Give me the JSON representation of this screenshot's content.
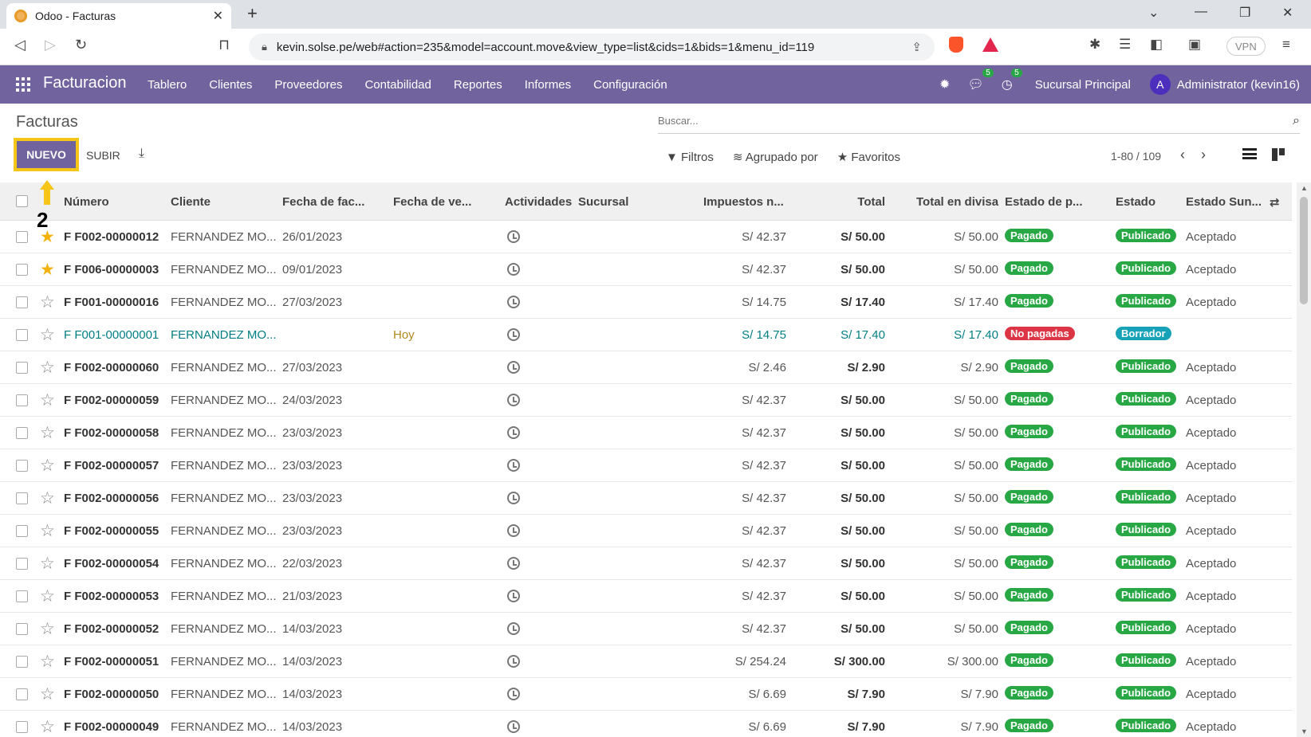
{
  "browser": {
    "tab_title": "Odoo - Facturas",
    "url": "kevin.solse.pe/web#action=235&model=account.move&view_type=list&cids=1&bids=1&menu_id=119",
    "vpn_label": "VPN"
  },
  "navbar": {
    "brand": "Facturacion",
    "menu": [
      "Tablero",
      "Clientes",
      "Proveedores",
      "Contabilidad",
      "Reportes",
      "Informes",
      "Configuración"
    ],
    "messages_count": "5",
    "activities_count": "5",
    "branch": "Sucursal Principal",
    "avatar_letter": "A",
    "user": "Administrator (kevin16)",
    "color": "#71639e"
  },
  "control": {
    "breadcrumb": "Facturas",
    "search_placeholder": "Buscar...",
    "new_label": "NUEVO",
    "upload_label": "SUBIR",
    "filters_label": "Filtros",
    "groupby_label": "Agrupado por",
    "favorites_label": "Favoritos",
    "pager": "1-80 / 109"
  },
  "annotation": {
    "step": "2"
  },
  "table": {
    "headers": {
      "numero": "Número",
      "cliente": "Cliente",
      "fecha_fac": "Fecha de fac...",
      "fecha_ven": "Fecha de ve...",
      "actividades": "Actividades",
      "sucursal": "Sucursal",
      "impuestos": "Impuestos n...",
      "total": "Total",
      "total_divisa": "Total en divisa",
      "estado_pago": "Estado de p...",
      "estado": "Estado",
      "estado_sunat": "Estado Sun..."
    },
    "rows": [
      {
        "numero": "F F002-00000012",
        "cliente": "FERNANDEZ MO...",
        "fecha": "26/01/2023",
        "venc": "",
        "impuestos": "S/ 42.37",
        "total": "S/ 50.00",
        "divisa": "S/ 50.00",
        "pago": "Pagado",
        "estado": "Publicado",
        "sunat": "Aceptado"
      },
      {
        "numero": "F F006-00000003",
        "cliente": "FERNANDEZ MO...",
        "fecha": "09/01/2023",
        "venc": "",
        "impuestos": "S/ 42.37",
        "total": "S/ 50.00",
        "divisa": "S/ 50.00",
        "pago": "Pagado",
        "estado": "Publicado",
        "sunat": "Aceptado"
      },
      {
        "numero": "F F001-00000016",
        "cliente": "FERNANDEZ MO...",
        "fecha": "27/03/2023",
        "venc": "",
        "impuestos": "S/ 14.75",
        "total": "S/ 17.40",
        "divisa": "S/ 17.40",
        "pago": "Pagado",
        "estado": "Publicado",
        "sunat": "Aceptado"
      },
      {
        "numero": "F F001-00000001",
        "cliente": "FERNANDEZ MO...",
        "fecha": "",
        "venc": "Hoy",
        "impuestos": "S/ 14.75",
        "total": "S/ 17.40",
        "divisa": "S/ 17.40",
        "pago": "No pagadas",
        "estado": "Borrador",
        "sunat": ""
      },
      {
        "numero": "F F002-00000060",
        "cliente": "FERNANDEZ MO...",
        "fecha": "27/03/2023",
        "venc": "",
        "impuestos": "S/ 2.46",
        "total": "S/ 2.90",
        "divisa": "S/ 2.90",
        "pago": "Pagado",
        "estado": "Publicado",
        "sunat": "Aceptado"
      },
      {
        "numero": "F F002-00000059",
        "cliente": "FERNANDEZ MO...",
        "fecha": "24/03/2023",
        "venc": "",
        "impuestos": "S/ 42.37",
        "total": "S/ 50.00",
        "divisa": "S/ 50.00",
        "pago": "Pagado",
        "estado": "Publicado",
        "sunat": "Aceptado"
      },
      {
        "numero": "F F002-00000058",
        "cliente": "FERNANDEZ MO...",
        "fecha": "23/03/2023",
        "venc": "",
        "impuestos": "S/ 42.37",
        "total": "S/ 50.00",
        "divisa": "S/ 50.00",
        "pago": "Pagado",
        "estado": "Publicado",
        "sunat": "Aceptado"
      },
      {
        "numero": "F F002-00000057",
        "cliente": "FERNANDEZ MO...",
        "fecha": "23/03/2023",
        "venc": "",
        "impuestos": "S/ 42.37",
        "total": "S/ 50.00",
        "divisa": "S/ 50.00",
        "pago": "Pagado",
        "estado": "Publicado",
        "sunat": "Aceptado"
      },
      {
        "numero": "F F002-00000056",
        "cliente": "FERNANDEZ MO...",
        "fecha": "23/03/2023",
        "venc": "",
        "impuestos": "S/ 42.37",
        "total": "S/ 50.00",
        "divisa": "S/ 50.00",
        "pago": "Pagado",
        "estado": "Publicado",
        "sunat": "Aceptado"
      },
      {
        "numero": "F F002-00000055",
        "cliente": "FERNANDEZ MO...",
        "fecha": "23/03/2023",
        "venc": "",
        "impuestos": "S/ 42.37",
        "total": "S/ 50.00",
        "divisa": "S/ 50.00",
        "pago": "Pagado",
        "estado": "Publicado",
        "sunat": "Aceptado"
      },
      {
        "numero": "F F002-00000054",
        "cliente": "FERNANDEZ MO...",
        "fecha": "22/03/2023",
        "venc": "",
        "impuestos": "S/ 42.37",
        "total": "S/ 50.00",
        "divisa": "S/ 50.00",
        "pago": "Pagado",
        "estado": "Publicado",
        "sunat": "Aceptado"
      },
      {
        "numero": "F F002-00000053",
        "cliente": "FERNANDEZ MO...",
        "fecha": "21/03/2023",
        "venc": "",
        "impuestos": "S/ 42.37",
        "total": "S/ 50.00",
        "divisa": "S/ 50.00",
        "pago": "Pagado",
        "estado": "Publicado",
        "sunat": "Aceptado"
      },
      {
        "numero": "F F002-00000052",
        "cliente": "FERNANDEZ MO...",
        "fecha": "14/03/2023",
        "venc": "",
        "impuestos": "S/ 42.37",
        "total": "S/ 50.00",
        "divisa": "S/ 50.00",
        "pago": "Pagado",
        "estado": "Publicado",
        "sunat": "Aceptado"
      },
      {
        "numero": "F F002-00000051",
        "cliente": "FERNANDEZ MO...",
        "fecha": "14/03/2023",
        "venc": "",
        "impuestos": "S/ 254.24",
        "total": "S/ 300.00",
        "divisa": "S/ 300.00",
        "pago": "Pagado",
        "estado": "Publicado",
        "sunat": "Aceptado"
      },
      {
        "numero": "F F002-00000050",
        "cliente": "FERNANDEZ MO...",
        "fecha": "14/03/2023",
        "venc": "",
        "impuestos": "S/ 6.69",
        "total": "S/ 7.90",
        "divisa": "S/ 7.90",
        "pago": "Pagado",
        "estado": "Publicado",
        "sunat": "Aceptado"
      },
      {
        "numero": "F F002-00000049",
        "cliente": "FERNANDEZ MO...",
        "fecha": "14/03/2023",
        "venc": "",
        "impuestos": "S/ 6.69",
        "total": "S/ 7.90",
        "divisa": "S/ 7.90",
        "pago": "Pagado",
        "estado": "Publicado",
        "sunat": "Aceptado"
      }
    ]
  }
}
